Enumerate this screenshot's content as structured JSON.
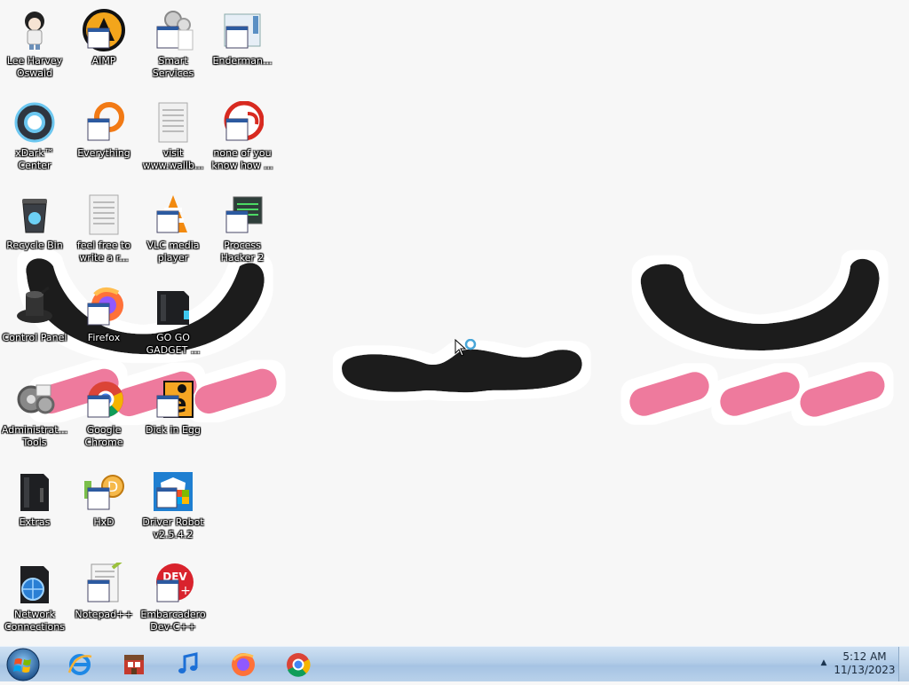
{
  "desktop": {
    "icons": [
      {
        "id": "lee-harvey-oswald",
        "label": "Lee Harvey Oswald",
        "icon": "anime-character-icon"
      },
      {
        "id": "aimp",
        "label": "AIMP",
        "icon": "aimp-icon"
      },
      {
        "id": "smart-services",
        "label": "Smart Services",
        "icon": "gears-icon"
      },
      {
        "id": "enderman",
        "label": "Enderman...",
        "icon": "window-icon"
      },
      {
        "id": "xdark-center",
        "label": "xDark™ Center",
        "icon": "xdark-icon"
      },
      {
        "id": "everything",
        "label": "Everything",
        "icon": "everything-search-icon"
      },
      {
        "id": "visit-wallb",
        "label": "visit www.wallb...",
        "icon": "text-document-icon"
      },
      {
        "id": "none-of-you",
        "label": "none of you know how ...",
        "icon": "red-face-icon"
      },
      {
        "id": "recycle-bin",
        "label": "Recycle Bin",
        "icon": "recycle-bin-icon"
      },
      {
        "id": "feel-free",
        "label": "feel free to write a r...",
        "icon": "text-document-icon"
      },
      {
        "id": "vlc",
        "label": "VLC media player",
        "icon": "vlc-cone-icon"
      },
      {
        "id": "process-hacker",
        "label": "Process Hacker 2",
        "icon": "process-hacker-icon"
      },
      {
        "id": "control-panel",
        "label": "Control Panel",
        "icon": "control-panel-icon"
      },
      {
        "id": "firefox",
        "label": "Firefox",
        "icon": "firefox-icon"
      },
      {
        "id": "go-go-gadget",
        "label": "GO GO GADGET ...",
        "icon": "dark-folder-icon"
      },
      {
        "id": "admin-tools",
        "label": "Administrat... Tools",
        "icon": "admin-tools-icon"
      },
      {
        "id": "google-chrome",
        "label": "Google Chrome",
        "icon": "chrome-icon"
      },
      {
        "id": "dick-in-egg",
        "label": "Dick in Egg",
        "icon": "dick-in-egg-icon"
      },
      {
        "id": "extras",
        "label": "Extras",
        "icon": "dark-folder-icon"
      },
      {
        "id": "hxd",
        "label": "HxD",
        "icon": "hxd-icon"
      },
      {
        "id": "driver-robot",
        "label": "Driver Robot v2.5.4.2",
        "icon": "driver-robot-icon"
      },
      {
        "id": "network-connections",
        "label": "Network Connections",
        "icon": "network-folder-icon"
      },
      {
        "id": "notepad-plus-plus",
        "label": "Notepad++",
        "icon": "notepad-plus-plus-icon"
      },
      {
        "id": "embarcadero",
        "label": "Embarcadero Dev-C++",
        "icon": "devcpp-icon"
      }
    ]
  },
  "taskbar": {
    "start_icon": "windows-orb-icon",
    "pinned": [
      {
        "id": "internet-explorer",
        "icon": "internet-explorer-icon"
      },
      {
        "id": "store",
        "icon": "store-icon"
      },
      {
        "id": "music",
        "icon": "music-note-icon"
      },
      {
        "id": "firefox",
        "icon": "firefox-icon"
      },
      {
        "id": "chrome",
        "icon": "chrome-icon"
      }
    ],
    "tray_arrow": "▲",
    "clock": {
      "time": "5:12 AM",
      "date": "11/13/2023"
    }
  },
  "colors": {
    "wallpaper_bg": "#f7f7f7",
    "face_black": "#1e1e1e",
    "blush_pink": "#ee7a9d",
    "taskbar": "#b3cde8"
  }
}
